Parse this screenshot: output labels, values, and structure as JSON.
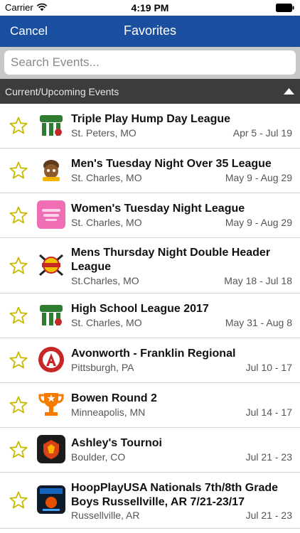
{
  "status_bar": {
    "carrier": "Carrier",
    "time": "4:19 PM"
  },
  "navbar": {
    "cancel_label": "Cancel",
    "title": "Favorites"
  },
  "search": {
    "placeholder": "Search Events..."
  },
  "section": {
    "title": "Current/Upcoming Events"
  },
  "colors": {
    "nav_blue": "#1a4fa0",
    "star_yellow": "#c9b800",
    "section_dark": "#3c3c3c"
  },
  "events": [
    {
      "name": "Triple Play Hump Day League",
      "location": "St. Peters, MO",
      "dates": "Apr 5 - Jul 19",
      "logo": "green-league-logo"
    },
    {
      "name": "Men's Tuesday Night Over 35 League",
      "location": "St. Charles, MO",
      "dates": "May 9 - Aug 29",
      "logo": "mascot-logo"
    },
    {
      "name": "Women's Tuesday Night League",
      "location": "St. Charles, MO",
      "dates": "May 9 - Aug 29",
      "logo": "pink-logo"
    },
    {
      "name": "Mens Thursday Night Double Header League",
      "location": "St.Charles, MO",
      "dates": "May 18 - Jul 18",
      "logo": "softball-logo"
    },
    {
      "name": "High School League 2017",
      "location": "St. Charles, MO",
      "dates": "May 31 - Aug 8",
      "logo": "green-league-logo"
    },
    {
      "name": "Avonworth  - Franklin Regional",
      "location": "Pittsburgh, PA",
      "dates": "Jul 10 - 17",
      "logo": "avonworth-a-logo"
    },
    {
      "name": "Bowen Round 2",
      "location": "Minneapolis, MN",
      "dates": "Jul 14 - 17",
      "logo": "trophy-logo"
    },
    {
      "name": "Ashley's Tournoi",
      "location": "Boulder, CO",
      "dates": "Jul 21 - 23",
      "logo": "dark-app-logo"
    },
    {
      "name": "HoopPlayUSA Nationals 7th/8th Grade Boys Russellville, AR 7/21-23/17",
      "location": "Russellville, AR",
      "dates": "Jul 21 - 23",
      "logo": "hoopplay-logo"
    }
  ]
}
